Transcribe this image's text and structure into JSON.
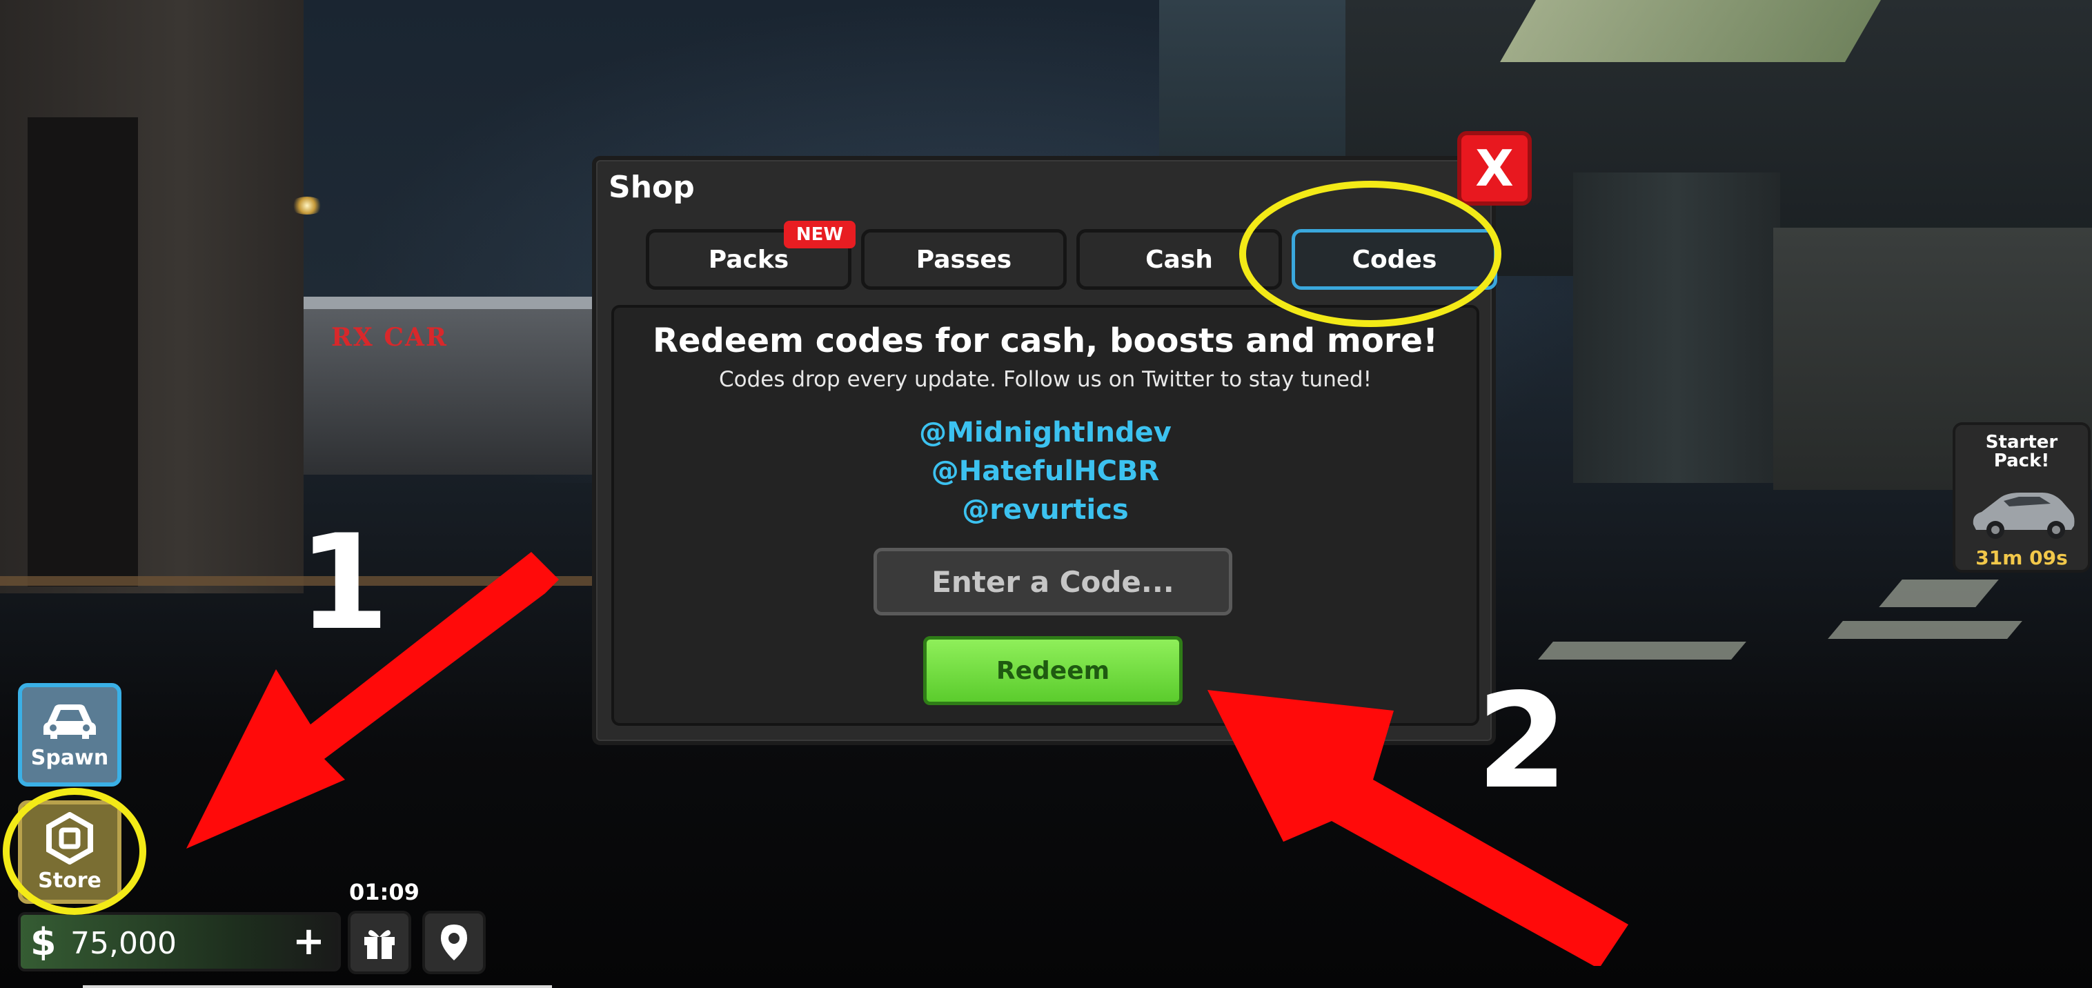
{
  "shop": {
    "title": "Shop",
    "close_label": "X",
    "tabs": [
      {
        "label": "Packs",
        "badge": "NEW",
        "active": false
      },
      {
        "label": "Passes",
        "active": false
      },
      {
        "label": "Cash",
        "active": false
      },
      {
        "label": "Codes",
        "active": true
      }
    ],
    "headline": "Redeem codes for cash, boosts and more!",
    "subline": "Codes drop every update. Follow us on Twitter to stay tuned!",
    "handles": [
      "@MidnightIndev",
      "@HatefulHCBR",
      "@revurtics"
    ],
    "code_input": {
      "placeholder": "Enter a Code...",
      "value": ""
    },
    "redeem_label": "Redeem"
  },
  "hud": {
    "spawn_label": "Spawn",
    "store_label": "Store",
    "cash_symbol": "$",
    "cash_value": "75,000",
    "cash_add": "+",
    "timer": "01:09",
    "gift_icon": "gift-icon",
    "map_icon": "map-pin-icon"
  },
  "starter_pack": {
    "title": "Starter Pack!",
    "timer": "31m 09s"
  },
  "annotations": {
    "step1": "1",
    "step2": "2"
  },
  "scene": {
    "dealer_sign": "RX CAR"
  },
  "colors": {
    "accent_blue": "#3aa8dd",
    "handle_blue": "#3cc2f0",
    "close_red": "#e8181f",
    "redeem_green": "#5bcc2d",
    "highlight_yellow": "#f3ea17",
    "arrow_red": "#ff0a0a"
  }
}
